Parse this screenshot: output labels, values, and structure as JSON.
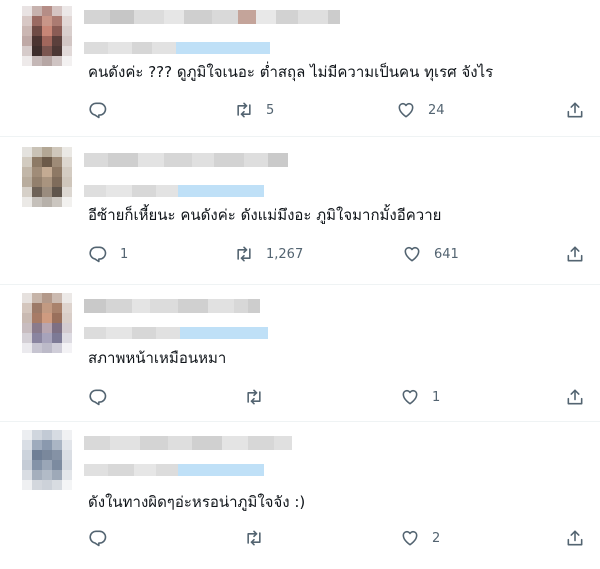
{
  "tweets": [
    {
      "text": "คนดังค่ะ ??? ดูภูมิใจเนอะ ต่ำสถุล ไม่มีความเป็นคน ทุเรศ จังไร",
      "reply_count": "",
      "retweet_count": "5",
      "like_count": "24"
    },
    {
      "text": "อีซ้ายก็เหี้ยนะ คนดังค่ะ ดังแม่มึงอะ ภูมิใจมากมั้งอีควาย",
      "reply_count": "1",
      "retweet_count": "1,267",
      "like_count": "641"
    },
    {
      "text": "สภาพหน้าเหมือนหมา",
      "reply_count": "",
      "retweet_count": "",
      "like_count": "1"
    },
    {
      "text": "ดังในทางผิดๆอ่ะหรอน่าภูมิใจจัง :)",
      "reply_count": "",
      "retweet_count": "",
      "like_count": "2"
    }
  ],
  "icons": {
    "reply": "reply-icon",
    "retweet": "retweet-icon",
    "like": "heart-icon",
    "share": "share-icon"
  },
  "colors": {
    "text": "#0f1419",
    "icon": "#536471",
    "divider": "#eff3f4",
    "blur_blue": "#bfe0f7"
  }
}
